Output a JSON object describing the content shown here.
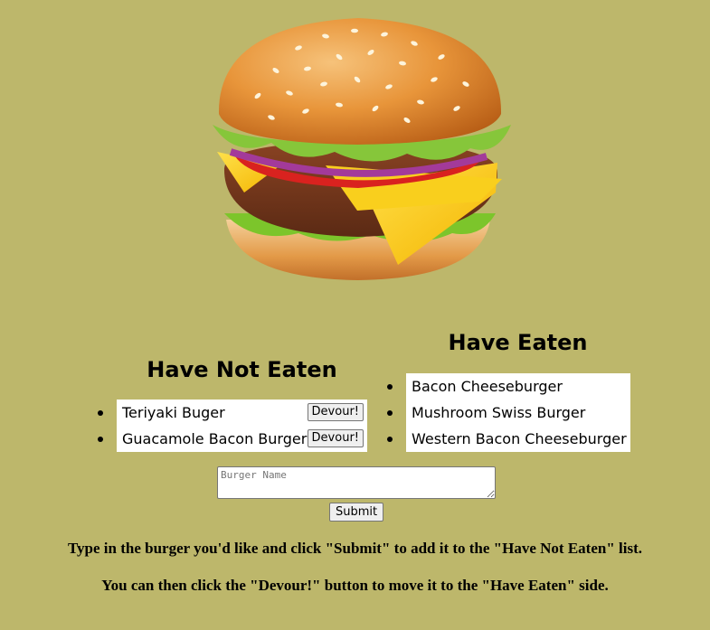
{
  "have_not_eaten": {
    "heading": "Have Not Eaten",
    "items": [
      {
        "name": "Teriyaki Buger",
        "button": "Devour!"
      },
      {
        "name": "Guacamole Bacon Burger",
        "button": "Devour!"
      }
    ]
  },
  "have_eaten": {
    "heading": "Have Eaten",
    "items": [
      {
        "name": "Bacon Cheeseburger"
      },
      {
        "name": "Mushroom Swiss Burger"
      },
      {
        "name": "Western Bacon Cheeseburger"
      }
    ]
  },
  "form": {
    "placeholder": "Burger Name",
    "value": "",
    "submit_label": "Submit"
  },
  "instructions": [
    "Type in the burger you'd like and click \"Submit\" to add it to the \"Have Not Eaten\" list.",
    "You can then click the \"Devour!\" button to move it to the \"Have Eaten\" side."
  ],
  "colors": {
    "background": "#bdb76b",
    "list_background": "#ffffff"
  },
  "icons": {
    "hero": "hamburger-illustration"
  }
}
